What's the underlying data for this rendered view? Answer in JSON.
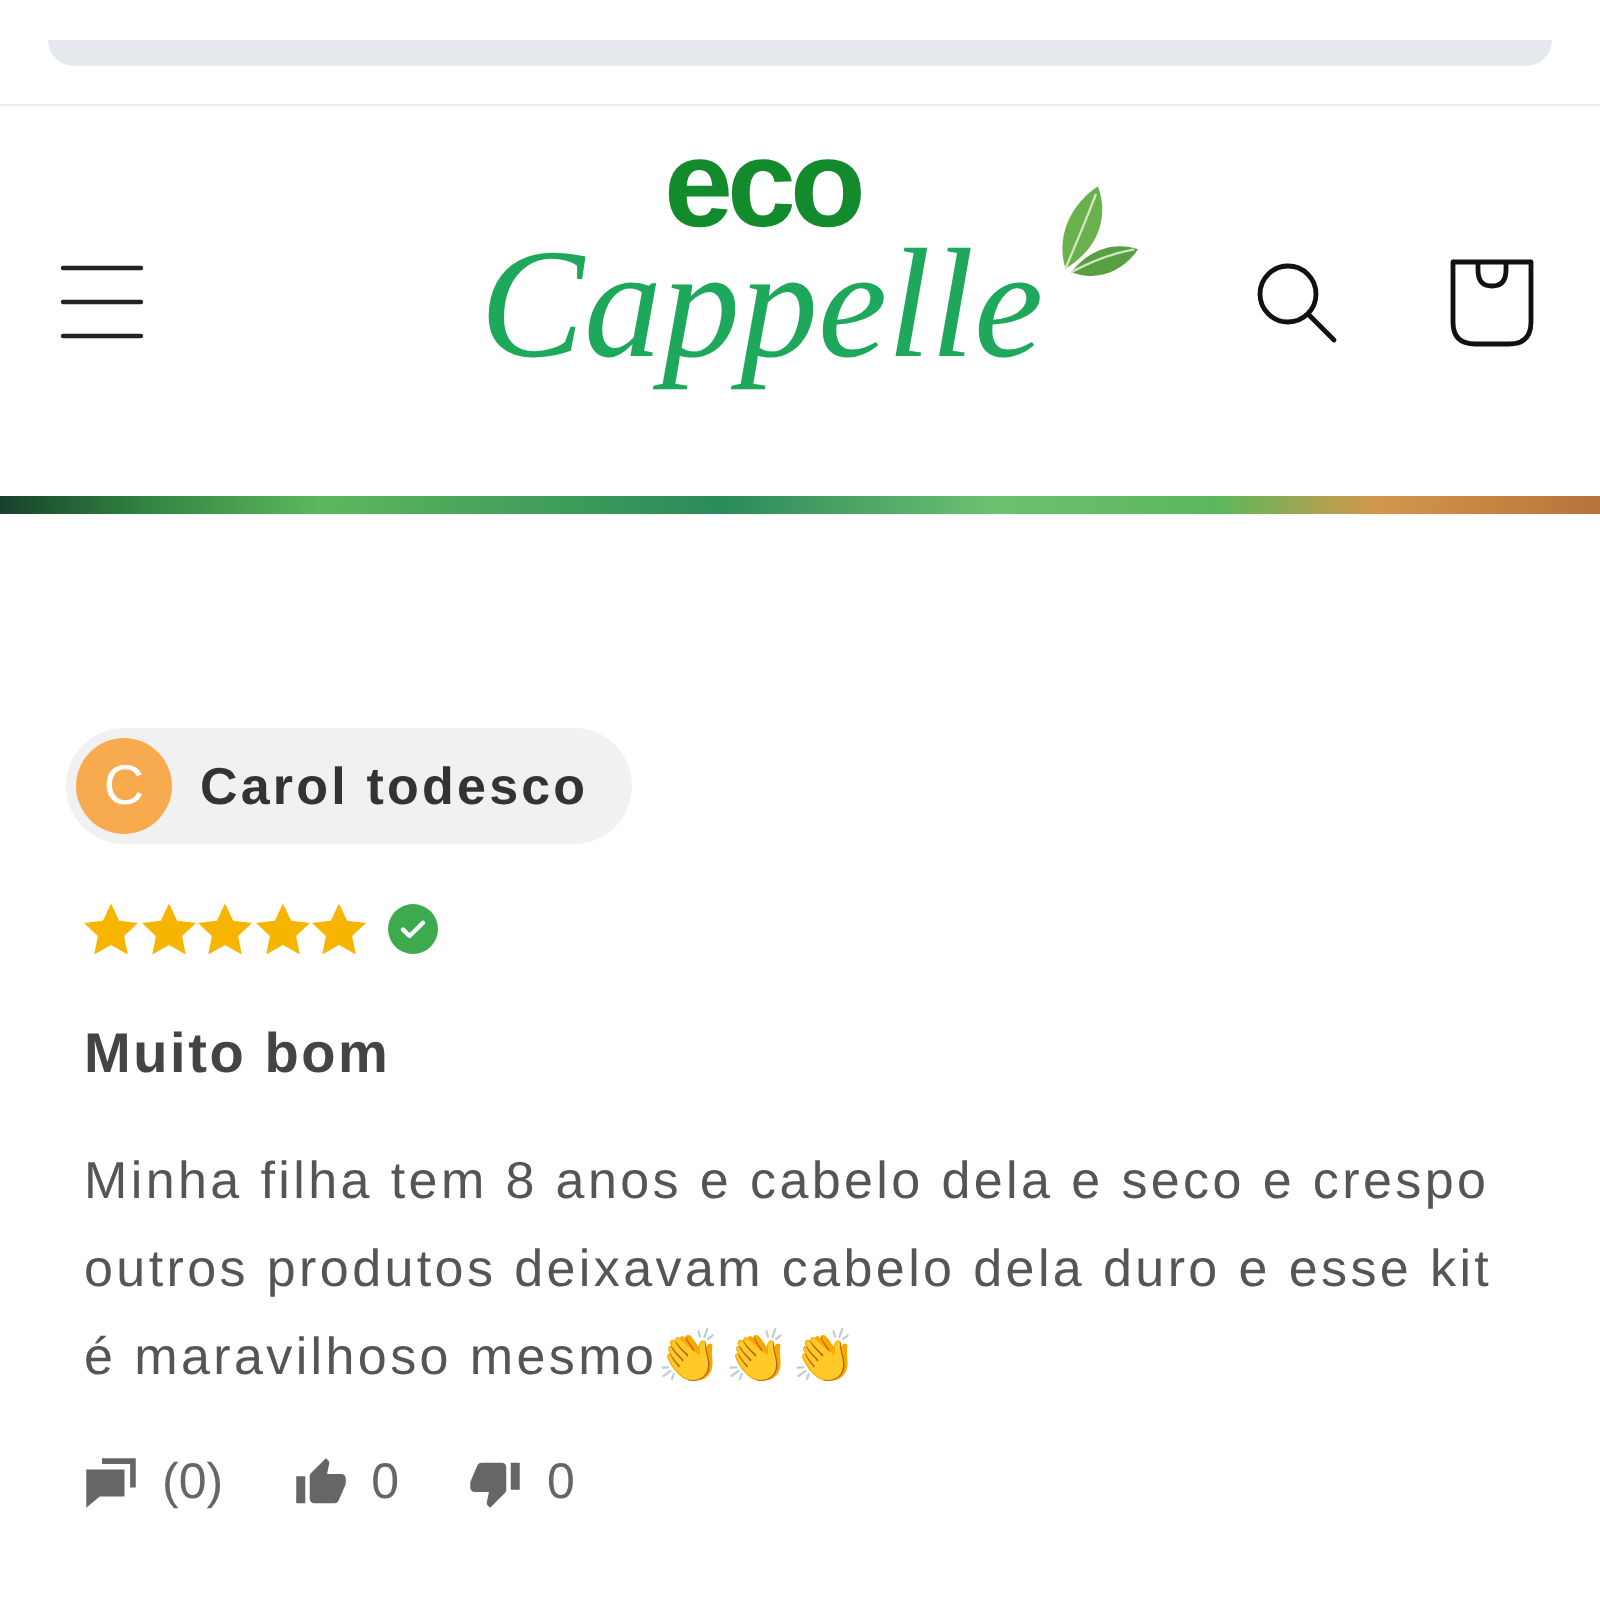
{
  "header": {
    "logo": {
      "prefix": "eco",
      "wordmark": "Cappelle"
    }
  },
  "review": {
    "author": {
      "initial": "C",
      "name": "Carol todesco"
    },
    "stars": 5,
    "verified": true,
    "title": "Muito bom",
    "body": "Minha filha tem 8 anos e cabelo dela e seco e crespo outros produtos deixavam cabelo dela duro e esse kit é maravilhoso mesmo👏👏👏",
    "actions": [
      {
        "kind": "comments",
        "count": "(0)"
      },
      {
        "kind": "likes",
        "count": "0"
      },
      {
        "kind": "dislikes",
        "count": "0"
      }
    ]
  }
}
